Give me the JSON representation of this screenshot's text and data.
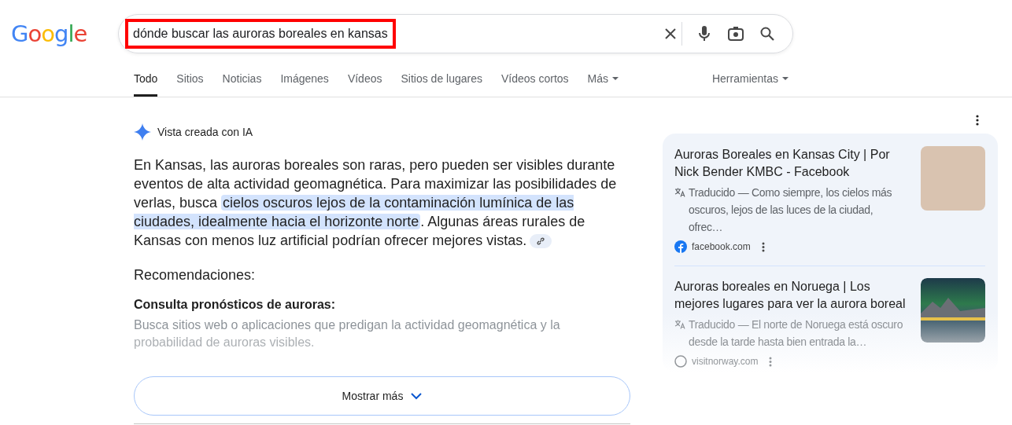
{
  "logo": "Google",
  "search": {
    "value": "dónde buscar las auroras boreales en kansas",
    "highlighted": true
  },
  "tabs": [
    {
      "label": "Todo",
      "selected": true,
      "dropdown": false
    },
    {
      "label": "Sitios",
      "selected": false,
      "dropdown": false
    },
    {
      "label": "Noticias",
      "selected": false,
      "dropdown": false
    },
    {
      "label": "Imágenes",
      "selected": false,
      "dropdown": false
    },
    {
      "label": "Vídeos",
      "selected": false,
      "dropdown": false
    },
    {
      "label": "Sitios de lugares",
      "selected": false,
      "dropdown": false
    },
    {
      "label": "Vídeos cortos",
      "selected": false,
      "dropdown": false
    },
    {
      "label": "Más",
      "selected": false,
      "dropdown": true
    }
  ],
  "tools": {
    "label": "Herramientas"
  },
  "ai_overview": {
    "label": "Vista creada con IA",
    "summary": {
      "before": "En Kansas, las auroras boreales son raras, pero pueden ser visibles durante eventos de alta actividad geomagnética. Para maximizar las posibilidades de verlas, busca ",
      "highlighted": "cielos oscuros lejos de la contaminación lumínica de las ciudades, idealmente hacia el horizonte norte",
      "after": ". Algunas áreas rurales de Kansas con menos luz artificial podrían ofrecer mejores vistas."
    },
    "section_title": "Recomendaciones:",
    "item_title": "Consulta pronósticos de auroras:",
    "item_text": "Busca sitios web o aplicaciones que predigan la actividad geomagnética y la probabilidad de auroras visibles.",
    "show_more": "Mostrar más"
  },
  "sources": [
    {
      "title": "Auroras Boreales en Kansas City | Por Nick Bender KMBC - Facebook",
      "snippet": "Traducido — Como siempre, los cielos más oscuros, lejos de las luces de la ciudad, ofrec…",
      "site": "facebook.com",
      "kind": "facebook",
      "faded": false
    },
    {
      "title": "Auroras boreales en Noruega | Los mejores lugares para ver la aurora boreal",
      "snippet": "Traducido — El norte de Noruega está oscuro desde la tarde hasta bien entrada la…",
      "site": "visitnorway.com",
      "kind": "globe",
      "faded": true
    }
  ]
}
